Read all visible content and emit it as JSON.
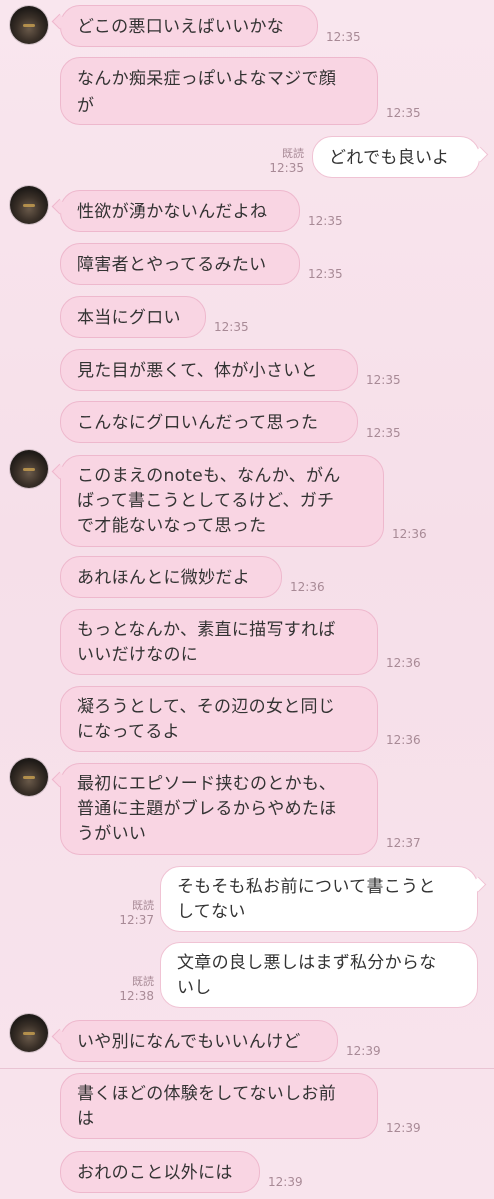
{
  "colors": {
    "incoming_bubble": "#f9d5e3",
    "outgoing_bubble": "#ffffff",
    "background": "#f8e4ed",
    "timestamp": "#a88a96"
  },
  "messages": [
    {
      "dir": "in",
      "text": "どこの悪口いえばいいかな",
      "time": "12:35"
    },
    {
      "dir": "in",
      "text": "なんか痴呆症っぽいよなマジで顔\nが",
      "time": "12:35"
    },
    {
      "dir": "out",
      "text": "どれでも良いよ",
      "read": "既読",
      "time": "12:35"
    },
    {
      "dir": "in",
      "text": "性欲が湧かないんだよね",
      "time": "12:35"
    },
    {
      "dir": "in",
      "text": "障害者とやってるみたい",
      "time": "12:35"
    },
    {
      "dir": "in",
      "text": "本当にグロい",
      "time": "12:35"
    },
    {
      "dir": "in",
      "text": "見た目が悪くて、体が小さいと",
      "time": "12:35"
    },
    {
      "dir": "in",
      "text": "こんなにグロいんだって思った",
      "time": "12:35"
    },
    {
      "dir": "in",
      "text": "このまえのnoteも、なんか、がん\nばって書こうとしてるけど、ガチ\nで才能ないなって思った",
      "time": "12:36"
    },
    {
      "dir": "in",
      "text": "あれほんとに微妙だよ",
      "time": "12:36"
    },
    {
      "dir": "in",
      "text": "もっとなんか、素直に描写すれば\nいいだけなのに",
      "time": "12:36"
    },
    {
      "dir": "in",
      "text": "凝ろうとして、その辺の女と同じ\nになってるよ",
      "time": "12:36"
    },
    {
      "dir": "in",
      "text": "最初にエピソード挟むのとかも、\n普通に主題がブレるからやめたほ\nうがいい",
      "time": "12:37"
    },
    {
      "dir": "out",
      "text": "そもそも私お前について書こうと\nしてない",
      "read": "既読",
      "time": "12:37"
    },
    {
      "dir": "out",
      "text": "文章の良し悪しはまず私分からな\nいし",
      "read": "既読",
      "time": "12:38"
    },
    {
      "dir": "in",
      "text": "いや別になんでもいいんけど",
      "time": "12:39"
    },
    {
      "dir": "in",
      "text": "書くほどの体験をしてないしお前\nは",
      "time": "12:39"
    },
    {
      "dir": "in",
      "text": "おれのこと以外には",
      "time": "12:39"
    }
  ]
}
